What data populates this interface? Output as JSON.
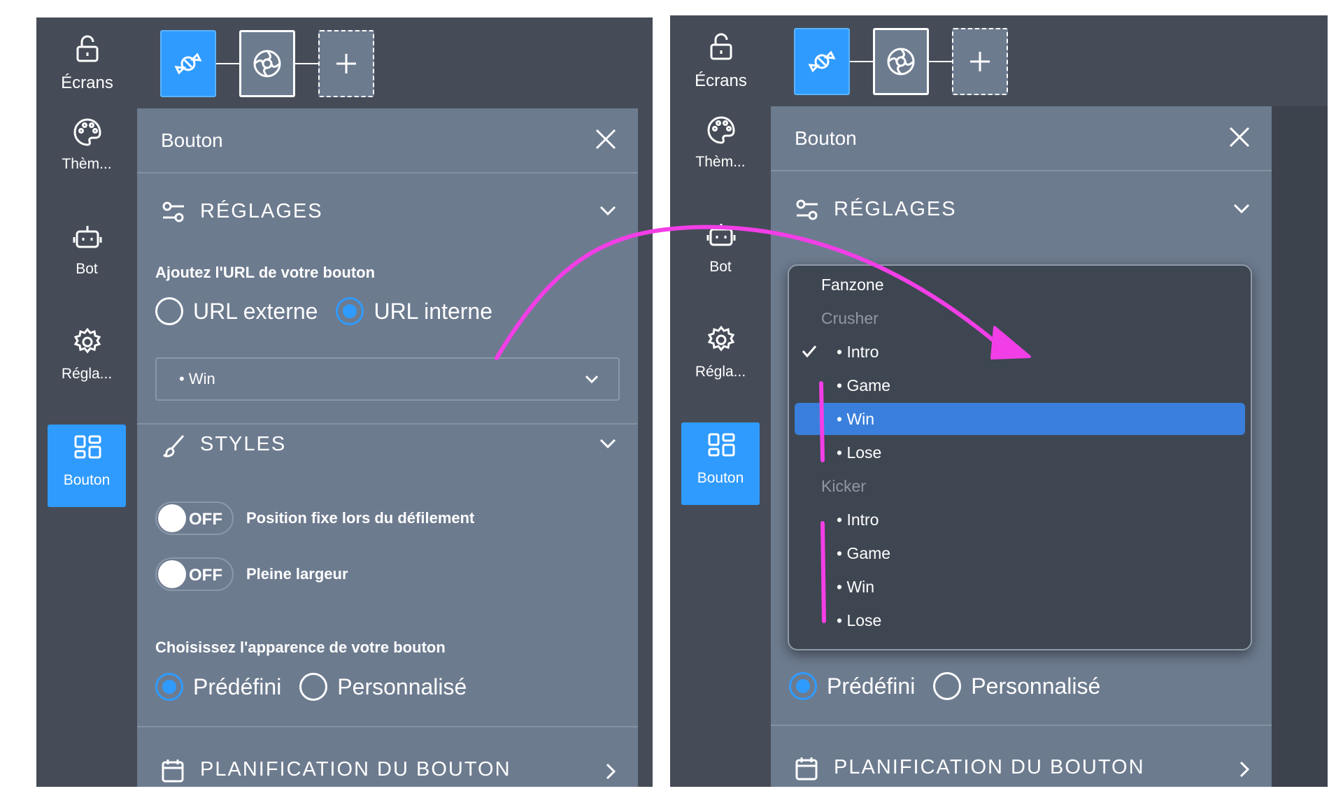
{
  "left": {
    "topbar": {
      "screens_label": "Écrans"
    },
    "sidebar": [
      {
        "key": "theme",
        "label": "Thèm...",
        "icon": "palette-icon"
      },
      {
        "key": "bot",
        "label": "Bot",
        "icon": "robot-icon"
      },
      {
        "key": "settings",
        "label": "Régla...",
        "icon": "gear-icon"
      },
      {
        "key": "button",
        "label": "Bouton",
        "icon": "grid-icon",
        "active": true
      }
    ],
    "panel": {
      "title": "Bouton",
      "settings_section": "RÉGLAGES",
      "url_label": "Ajoutez l'URL de votre bouton",
      "url_external": "URL externe",
      "url_internal": "URL interne",
      "url_selected": "internal",
      "select_value": "• Win",
      "styles_section": "STYLES",
      "toggle_fixed_state": "OFF",
      "toggle_fixed_label": "Position fixe lors du défilement",
      "toggle_width_state": "OFF",
      "toggle_width_label": "Pleine largeur",
      "appearance_label": "Choisissez l'apparence de votre bouton",
      "appearance_preset": "Prédéfini",
      "appearance_custom": "Personnalisé",
      "appearance_selected": "preset",
      "schedule_section": "PLANIFICATION DU BOUTON"
    }
  },
  "right": {
    "topbar": {
      "screens_label": "Écrans"
    },
    "sidebar": [
      {
        "key": "theme",
        "label": "Thèm...",
        "icon": "palette-icon"
      },
      {
        "key": "bot",
        "label": "Bot",
        "icon": "robot-icon"
      },
      {
        "key": "settings",
        "label": "Régla...",
        "icon": "gear-icon"
      },
      {
        "key": "button",
        "label": "Bouton",
        "icon": "grid-icon",
        "active": true
      }
    ],
    "panel": {
      "title": "Bouton",
      "settings_section": "RÉGLAGES",
      "appearance_preset": "Prédéfini",
      "appearance_custom": "Personnalisé",
      "schedule_section": "PLANIFICATION DU BOUTON"
    },
    "dropdown": {
      "items": [
        {
          "type": "group",
          "label": "Fanzone",
          "dim": false
        },
        {
          "type": "group",
          "label": "Crusher",
          "dim": true
        },
        {
          "type": "option",
          "label": "• Intro",
          "checked": true
        },
        {
          "type": "option",
          "label": "• Game"
        },
        {
          "type": "option",
          "label": "• Win",
          "selected": true
        },
        {
          "type": "option",
          "label": "• Lose"
        },
        {
          "type": "group",
          "label": "Kicker",
          "dim": true
        },
        {
          "type": "option",
          "label": "• Intro"
        },
        {
          "type": "option",
          "label": "• Game"
        },
        {
          "type": "option",
          "label": "• Win"
        },
        {
          "type": "option",
          "label": "• Lose"
        }
      ]
    }
  },
  "colors": {
    "accent": "#2f9bff",
    "panel_bg": "#6d7b8f",
    "frame_bg": "#454c57",
    "highlight": "#3a7fdc",
    "annotation": "#f23ee6"
  }
}
